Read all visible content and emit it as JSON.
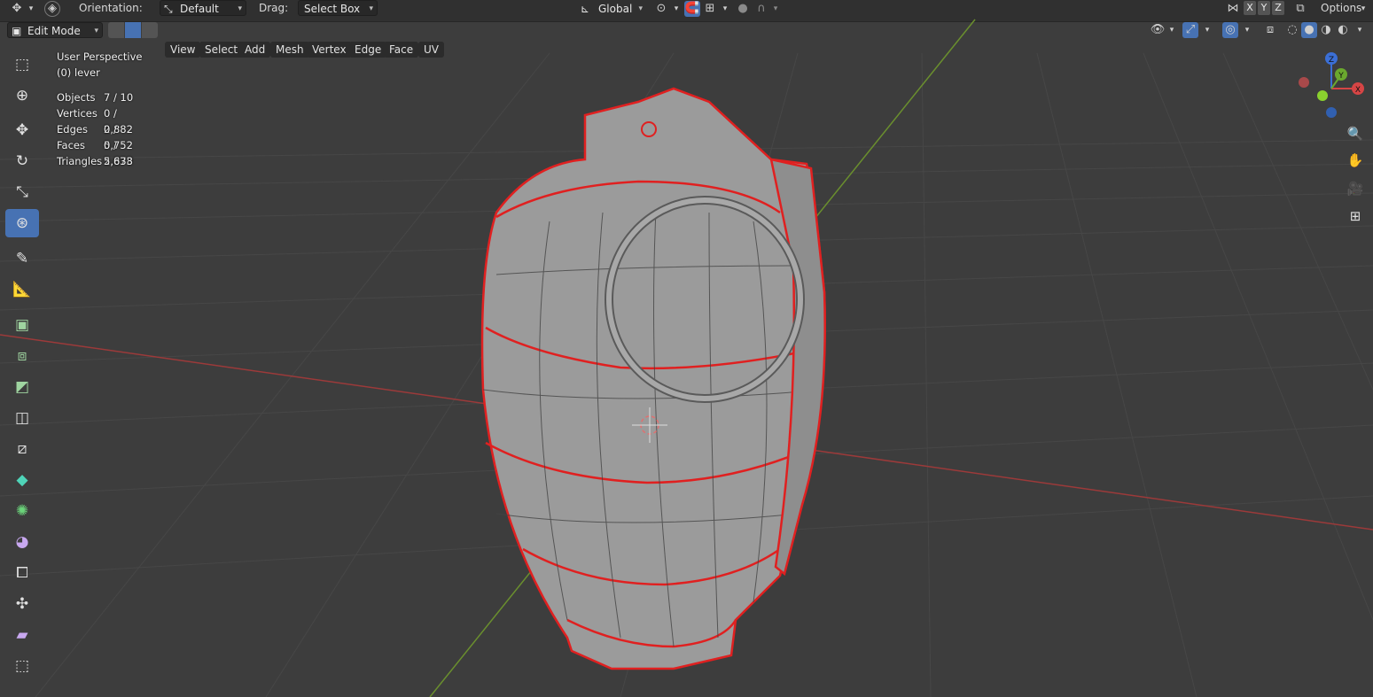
{
  "topbar": {
    "orientation_label": "Orientation:",
    "orientation_value": "Default",
    "drag_label": "Drag:",
    "drag_value": "Select Box",
    "transform_space": "Global",
    "axes": [
      "X",
      "Y",
      "Z"
    ],
    "options_label": "Options"
  },
  "header": {
    "mode": "Edit Mode",
    "menus": [
      "View",
      "Select",
      "Add",
      "Mesh",
      "Vertex",
      "Edge",
      "Face",
      "UV"
    ]
  },
  "overlay": {
    "view_name": "User Perspective",
    "object_name": "(0) lever",
    "stats": [
      {
        "label": "Objects",
        "value": "7 / 10"
      },
      {
        "label": "Vertices",
        "value": "0 / 2,882"
      },
      {
        "label": "Edges",
        "value": "0 / 5,752"
      },
      {
        "label": "Faces",
        "value": "0 / 2,878"
      },
      {
        "label": "Triangles",
        "value": "5,633"
      }
    ]
  },
  "gizmo": {
    "x_label": "X",
    "y_label": "Y",
    "z_label": "Z"
  },
  "tools": [
    "select-box-icon",
    "cursor-icon",
    "move-icon",
    "rotate-icon",
    "scale-icon",
    "transform-icon",
    "annotate-icon",
    "measure-icon",
    "extrude-icon",
    "inset-icon",
    "bevel-icon",
    "loop-cut-icon",
    "knife-icon",
    "poly-build-icon",
    "spin-icon",
    "smooth-icon",
    "edge-slide-icon",
    "shrink-fatten-icon",
    "shear-icon",
    "rip-icon"
  ],
  "colors": {
    "viewport_bg": "#3d3d3d",
    "grid_line": "#4a4a4a",
    "x_axis": "#9c3a3a",
    "y_axis": "#6a8f2e",
    "mesh_fill": "#9a9a9a",
    "selection_edge": "#e02020",
    "active_tool": "#4772b3"
  }
}
